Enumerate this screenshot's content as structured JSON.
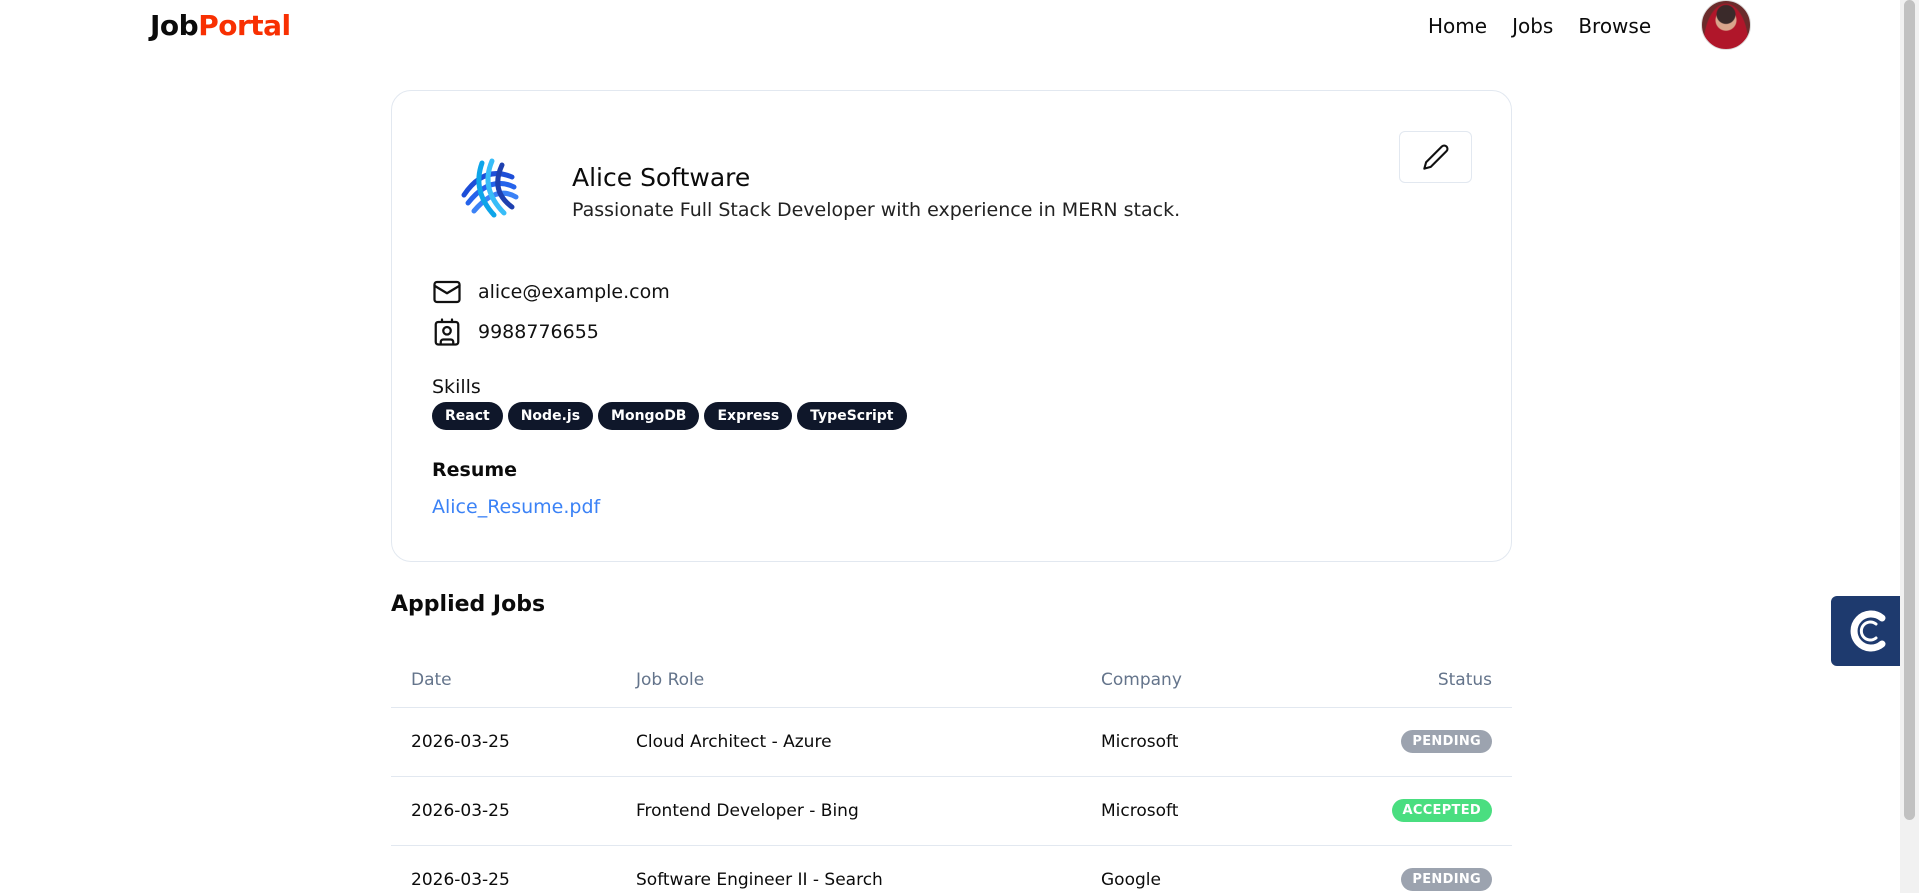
{
  "navbar": {
    "logo_part1": "Job",
    "logo_part2": "Portal",
    "links": [
      "Home",
      "Jobs",
      "Browse"
    ]
  },
  "profile": {
    "name": "Alice Software",
    "bio": "Passionate Full Stack Developer with experience in MERN stack.",
    "email": "alice@example.com",
    "phone": "9988776655",
    "skills_label": "Skills",
    "skills": [
      "React",
      "Node.js",
      "MongoDB",
      "Express",
      "TypeScript"
    ],
    "resume_label": "Resume",
    "resume_file": "Alice_Resume.pdf"
  },
  "applied_jobs": {
    "title": "Applied Jobs",
    "columns": [
      "Date",
      "Job Role",
      "Company",
      "Status"
    ],
    "rows": [
      {
        "date": "2026-03-25",
        "role": "Cloud Architect - Azure",
        "company": "Microsoft",
        "status": "PENDING"
      },
      {
        "date": "2026-03-25",
        "role": "Frontend Developer - Bing",
        "company": "Microsoft",
        "status": "ACCEPTED"
      },
      {
        "date": "2026-03-25",
        "role": "Software Engineer II - Search",
        "company": "Google",
        "status": "PENDING"
      }
    ]
  },
  "icons": {
    "edit": "pencil-icon",
    "email": "mail-icon",
    "phone": "contact-card-icon",
    "widget": "c-logo-icon"
  },
  "colors": {
    "brand_red": "#f83002",
    "badge_dark": "#0f172a",
    "link_blue": "#3b82f6",
    "pending": "#9ca3af",
    "accepted": "#4ade80"
  }
}
